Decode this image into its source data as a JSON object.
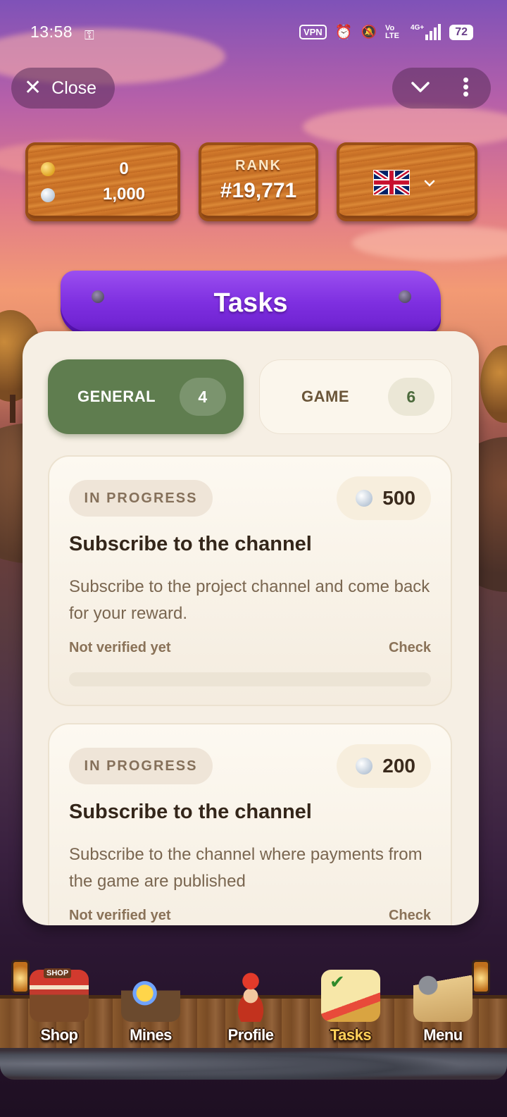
{
  "status_bar": {
    "time": "13:58",
    "icons": [
      "key-icon",
      "vpn-icon",
      "alarm-icon",
      "bell-off-icon",
      "volte-icon",
      "signal-4g-icon",
      "battery-icon"
    ],
    "vpn_label": "VPN",
    "volte_label": "Vo LTE",
    "network_label": "4G+",
    "battery": "72"
  },
  "top_bar": {
    "close_label": "Close"
  },
  "balances": {
    "gold": "0",
    "silver": "1,000"
  },
  "rank": {
    "label": "RANK",
    "value": "#19,771"
  },
  "language": {
    "flag": "uk-flag-icon"
  },
  "page_title": "Tasks",
  "tabs": [
    {
      "label": "GENERAL",
      "count": "4",
      "active": true
    },
    {
      "label": "GAME",
      "count": "6",
      "active": false
    }
  ],
  "tasks": [
    {
      "status": "IN PROGRESS",
      "reward": "500",
      "title": "Subscribe to the channel",
      "description": "Subscribe to the project channel and come back for your reward.",
      "verification": "Not verified yet",
      "action": "Check"
    },
    {
      "status": "IN PROGRESS",
      "reward": "200",
      "title": "Subscribe to the channel",
      "description": "Subscribe to the channel where payments from the game are published",
      "verification": "Not verified yet",
      "action": "Check"
    }
  ],
  "nav": [
    {
      "label": "Shop",
      "icon": "shop-icon",
      "shop_sign": "SHOP"
    },
    {
      "label": "Mines",
      "icon": "minecart-icon"
    },
    {
      "label": "Profile",
      "icon": "dwarf-miner-icon"
    },
    {
      "label": "Tasks",
      "icon": "tasks-checklist-icon",
      "active": true
    },
    {
      "label": "Menu",
      "icon": "map-gear-icon"
    }
  ],
  "colors": {
    "accent_green": "#5f7d4f",
    "banner_purple": "#7e2fe0",
    "active_nav_label": "#ffd15a",
    "panel_bg": "#f6efe4"
  }
}
